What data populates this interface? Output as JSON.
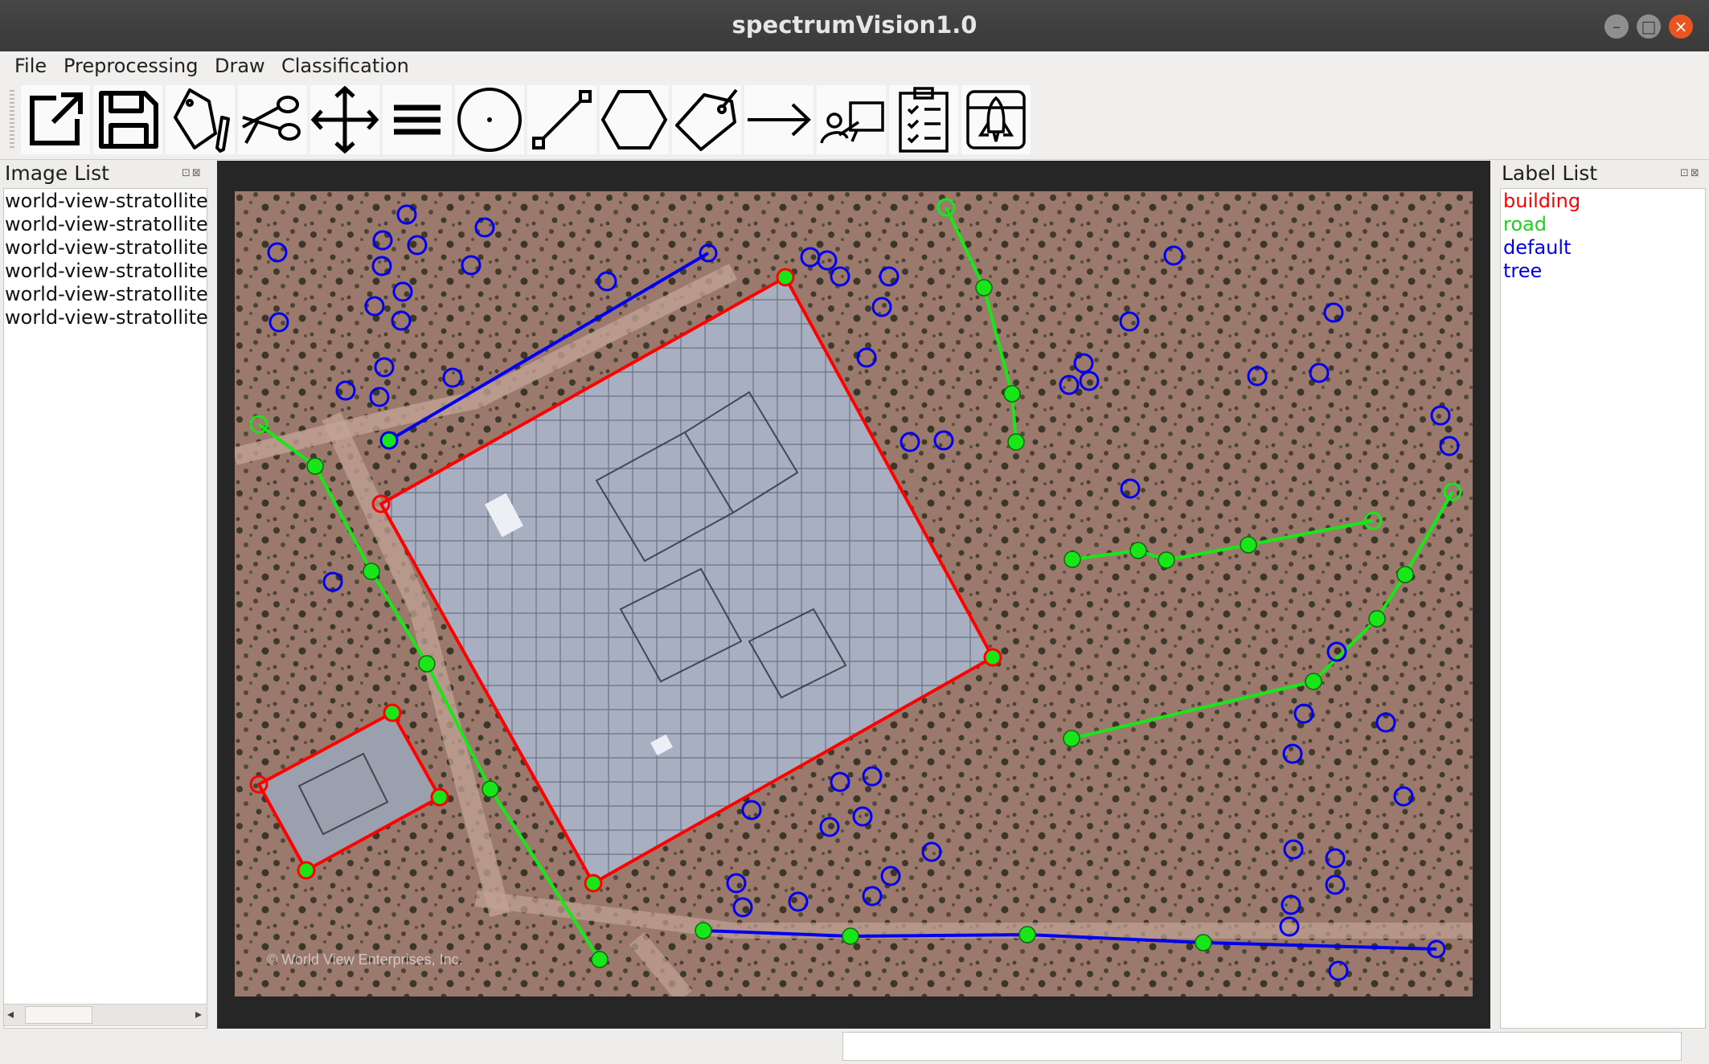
{
  "window": {
    "title": "spectrumVision1.0",
    "min_glyph": "–",
    "max_glyph": "□",
    "close_glyph": "×"
  },
  "menubar": {
    "file": "File",
    "preprocessing": "Preprocessing",
    "draw": "Draw",
    "classification": "Classification"
  },
  "toolbar": {
    "tools": [
      "open-icon",
      "save-icon",
      "label-edit-icon",
      "cut-icon",
      "move-icon",
      "menu-icon",
      "point-icon",
      "line-icon",
      "polygon-icon",
      "tag-icon",
      "arrow-icon",
      "annotate-icon",
      "clipboard-icon",
      "launch-icon"
    ]
  },
  "image_list": {
    "title": "Image List",
    "items": [
      "world-view-stratollite",
      "world-view-stratollite",
      "world-view-stratollite",
      "world-view-stratollite",
      "world-view-stratollite",
      "world-view-stratollite"
    ]
  },
  "label_list": {
    "title": "Label List",
    "items": [
      {
        "label": "building",
        "color": "#ff0000"
      },
      {
        "label": "road",
        "color": "#19d419"
      },
      {
        "label": "default",
        "color": "#0000ee"
      },
      {
        "label": "tree",
        "color": "#0000ee"
      }
    ]
  },
  "dock_buttons": "⊡⊠",
  "canvas": {
    "watermark": "© World View Enterprises, Inc.",
    "colors": {
      "building": "#ff0000",
      "road": "#19e619",
      "tree": "#0000ff",
      "vertex": "#19e619"
    }
  },
  "scroll_arrows": {
    "left": "◂",
    "right": "▸"
  }
}
